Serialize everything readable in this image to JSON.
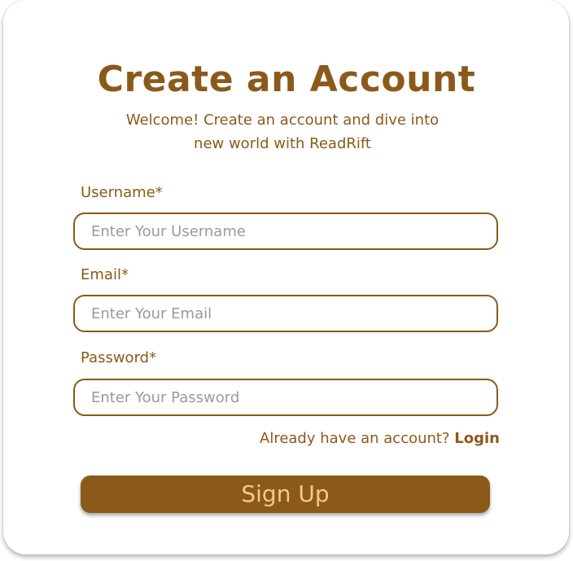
{
  "form": {
    "title": "Create an Account",
    "subtitle": "Welcome! Create an account and dive into new world with ReadRift",
    "fields": [
      {
        "label": "Username*",
        "placeholder": "Enter Your Username",
        "value": ""
      },
      {
        "label": "Email*",
        "placeholder": "Enter Your Email",
        "value": ""
      },
      {
        "label": "Password*",
        "placeholder": "Enter Your Password",
        "value": ""
      }
    ],
    "login_prompt": "Already have an account?",
    "login_link": "Login",
    "submit_label": "Sign Up"
  },
  "colors": {
    "accent": "#8b5a1a",
    "button_text": "#f5c986",
    "placeholder": "#9a9a9a"
  }
}
